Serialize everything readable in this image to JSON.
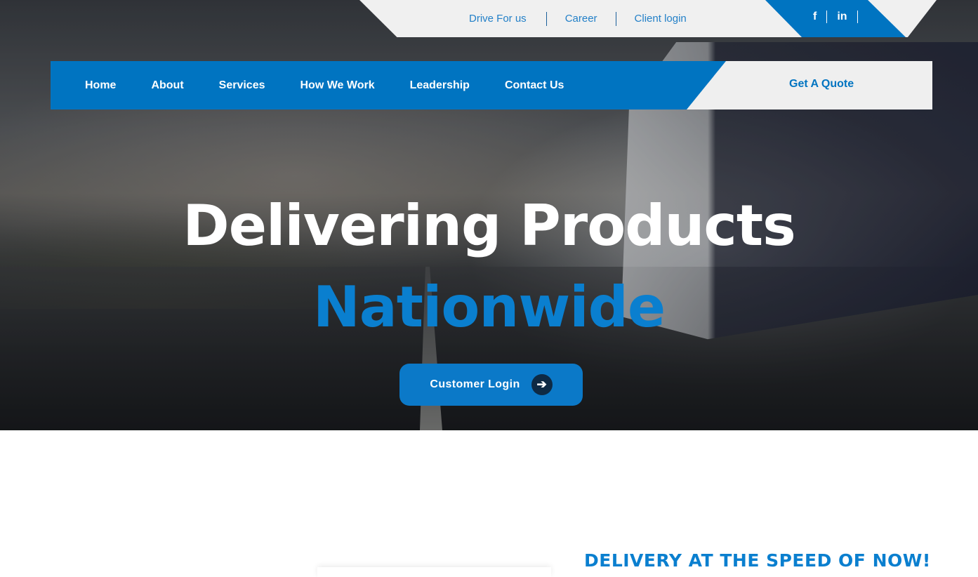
{
  "top_links": [
    "Drive For us",
    "Career",
    "Client login"
  ],
  "socials": [
    {
      "icon": "facebook-icon",
      "glyph": "f"
    },
    {
      "icon": "linkedin-icon",
      "glyph": "in"
    }
  ],
  "nav": {
    "items": [
      "Home",
      "About",
      "Services",
      "How We Work",
      "Leadership",
      "Contact Us"
    ],
    "quote_label": "Get A Quote"
  },
  "hero": {
    "line1": "Delivering Products",
    "line2": "Nationwide",
    "cta_label": "Customer Login",
    "cta_icon": "arrow-right-icon"
  },
  "section": {
    "tagline": "DELIVERY AT THE SPEED OF NOW!"
  },
  "colors": {
    "brand_blue": "#0074c1",
    "accent_blue": "#0a7fcf",
    "dark_navy": "#0e2a44",
    "light_gray": "#f0f0f0"
  }
}
